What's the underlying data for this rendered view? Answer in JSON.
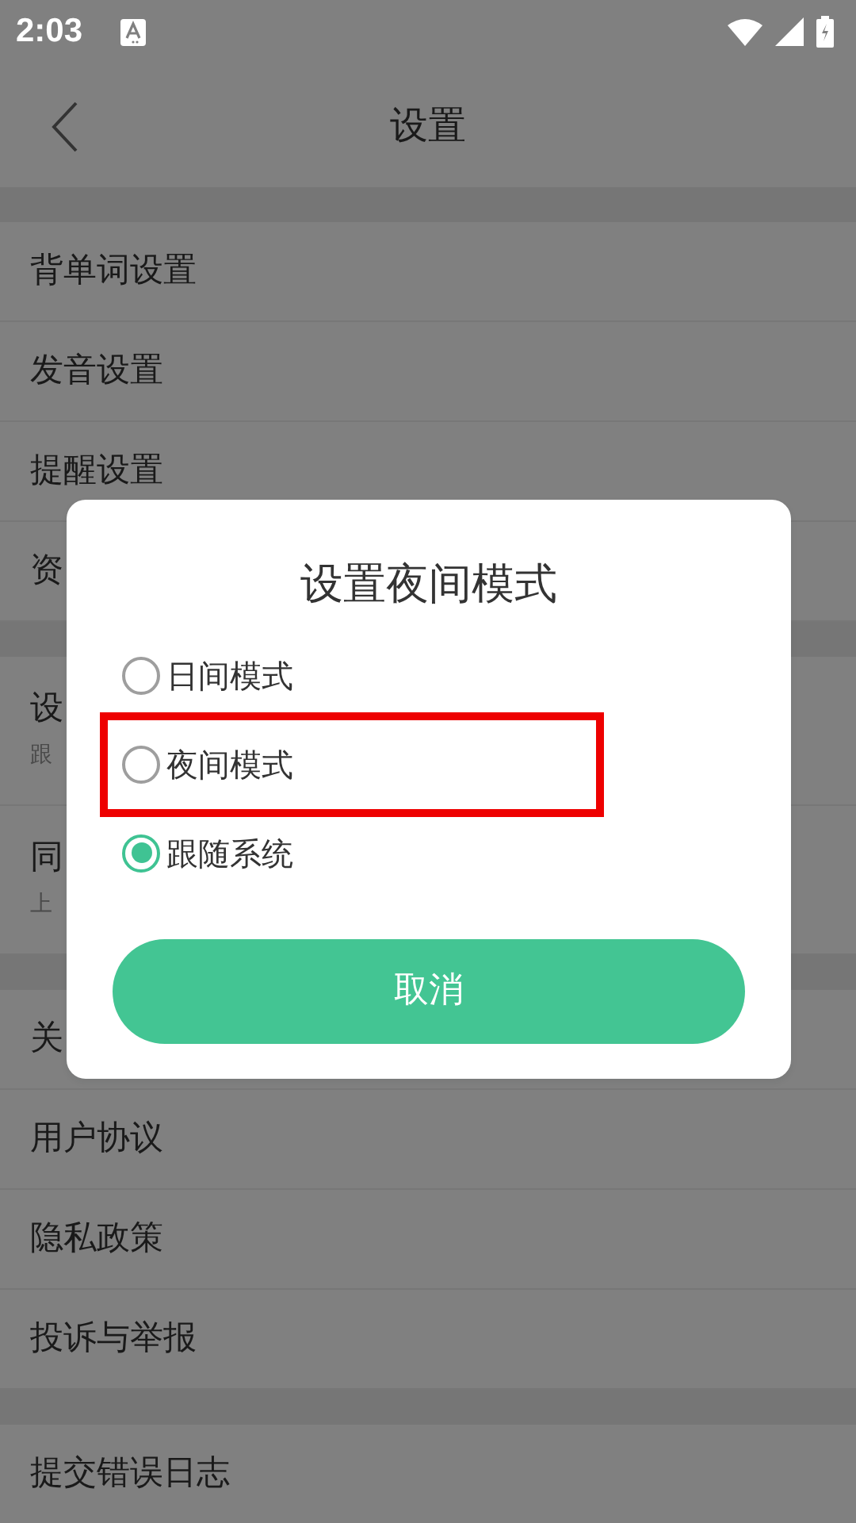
{
  "status_bar": {
    "time": "2:03"
  },
  "header": {
    "title": "设置"
  },
  "groups": [
    {
      "items": [
        {
          "label": "背单词设置"
        },
        {
          "label": "发音设置"
        },
        {
          "label": "提醒设置"
        },
        {
          "label": "资"
        }
      ]
    },
    {
      "items": [
        {
          "label": "设",
          "subtitle": "跟"
        },
        {
          "label": "同",
          "subtitle": "上"
        }
      ]
    },
    {
      "items": [
        {
          "label": "关"
        },
        {
          "label": "用户协议"
        },
        {
          "label": "隐私政策"
        },
        {
          "label": "投诉与举报"
        }
      ]
    },
    {
      "items": [
        {
          "label": "提交错误日志"
        }
      ]
    }
  ],
  "dialog": {
    "title": "设置夜间模式",
    "options": [
      {
        "label": "日间模式",
        "selected": false,
        "highlighted": false
      },
      {
        "label": "夜间模式",
        "selected": false,
        "highlighted": true
      },
      {
        "label": "跟随系统",
        "selected": true,
        "highlighted": false
      }
    ],
    "cancel_button": "取消"
  }
}
